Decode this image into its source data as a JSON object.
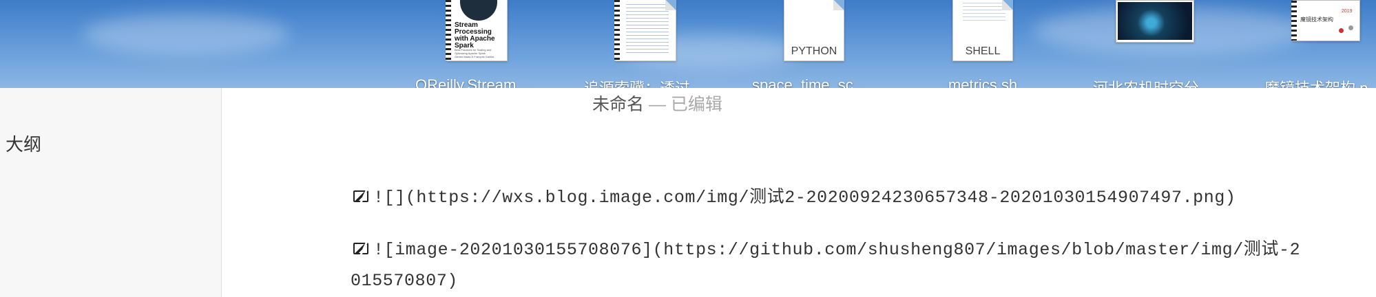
{
  "desktop": {
    "files": [
      {
        "name": "OReilly.Stream.Pro...",
        "kind": "book",
        "cover_title": "Stream Processing with Apache Spark",
        "cover_sub": "Best Practices for Scaling and Optimizing Apache Spark",
        "authors": "Gerard Maas & François Garillot"
      },
      {
        "name": "追源索骥：透过源码...",
        "kind": "document"
      },
      {
        "name": "space_time_scope...",
        "kind": "document",
        "type_label": "PYTHON"
      },
      {
        "name": "metrics.sh",
        "kind": "document",
        "type_label": "SHELL"
      },
      {
        "name": "河北农机时空分析报...",
        "kind": "screenshot"
      },
      {
        "name": "魔镜技术架构.pd...",
        "kind": "slide",
        "slide_title": "魔镜技术架构",
        "slide_year": "2019"
      }
    ]
  },
  "window": {
    "title": "未命名",
    "separator": " — ",
    "status": "已编辑"
  },
  "sidebar": {
    "title": "大纲"
  },
  "editor": {
    "lines": [
      "![](https://wxs.blog.image.com/img/测试2-20200924230657348-20201030154907497.png)",
      "![image-20201030155708076](https://github.com/shusheng807/images/blob/master/img/测试-2",
      "015570807)"
    ]
  }
}
